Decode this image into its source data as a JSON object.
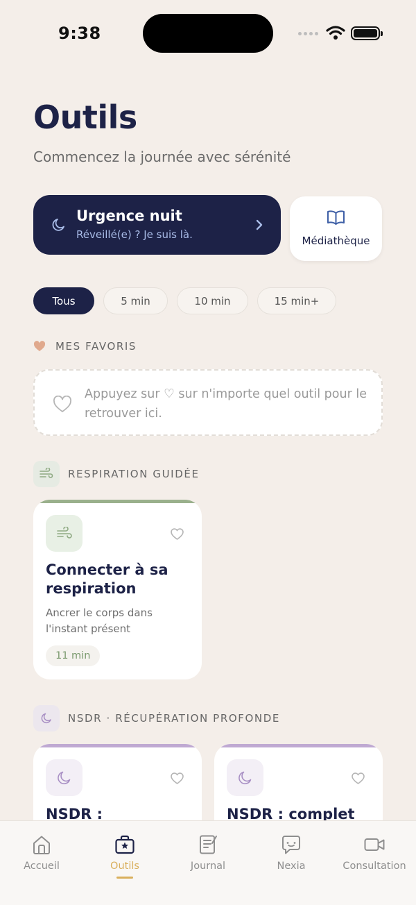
{
  "status_bar": {
    "time": "9:38"
  },
  "header": {
    "title": "Outils",
    "subtitle": "Commencez la journée avec sérénité"
  },
  "urgence": {
    "title": "Urgence nuit",
    "subtitle": "Réveillé(e) ? Je suis là."
  },
  "mediatheque": {
    "label": "Médiathèque"
  },
  "filters": [
    {
      "label": "Tous",
      "active": true
    },
    {
      "label": "5 min",
      "active": false
    },
    {
      "label": "10 min",
      "active": false
    },
    {
      "label": "15 min+",
      "active": false
    }
  ],
  "favorites": {
    "heading": "MES FAVORIS",
    "empty_text": "Appuyez sur ♡ sur n'importe quel outil pour le retrouver ici."
  },
  "respiration": {
    "heading": "RESPIRATION GUIDÉE",
    "cards": [
      {
        "title": "Connecter à sa respiration",
        "description": "Ancrer le corps dans l'instant présent",
        "duration": "11 min"
      }
    ]
  },
  "nsdr": {
    "heading": "NSDR · RÉCUPÉRATION PROFONDE",
    "cards": [
      {
        "title": "NSDR : découverte"
      },
      {
        "title": "NSDR : complet"
      }
    ]
  },
  "tabbar": {
    "items": [
      {
        "label": "Accueil",
        "icon": "home-icon"
      },
      {
        "label": "Outils",
        "icon": "toolbox-icon",
        "active": true
      },
      {
        "label": "Journal",
        "icon": "journal-icon"
      },
      {
        "label": "Nexia",
        "icon": "chat-icon"
      },
      {
        "label": "Consultation",
        "icon": "video-icon"
      }
    ]
  },
  "colors": {
    "background": "#F4EEE9",
    "navy": "#1D2247",
    "accent_gold": "#D9AF5C",
    "green": "#9AB08C",
    "purple": "#BFA9D2",
    "heart": "#E0A98D"
  }
}
